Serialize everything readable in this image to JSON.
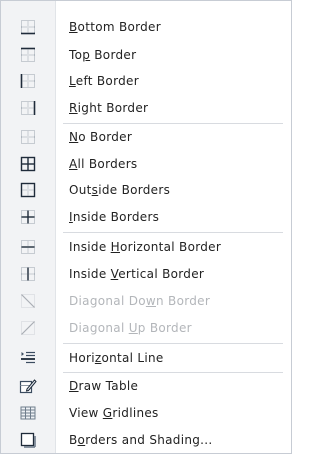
{
  "menu": {
    "items": [
      {
        "pre": "",
        "acc": "B",
        "post": "ottom Border",
        "icon": "border-bottom-icon",
        "enabled": true
      },
      {
        "pre": "To",
        "acc": "p",
        "post": " Border",
        "icon": "border-top-icon",
        "enabled": true
      },
      {
        "pre": "",
        "acc": "L",
        "post": "eft Border",
        "icon": "border-left-icon",
        "enabled": true
      },
      {
        "pre": "",
        "acc": "R",
        "post": "ight Border",
        "icon": "border-right-icon",
        "enabled": true
      },
      {
        "pre": "",
        "acc": "N",
        "post": "o Border",
        "icon": "no-border-icon",
        "enabled": true
      },
      {
        "pre": "",
        "acc": "A",
        "post": "ll Borders",
        "icon": "all-borders-icon",
        "enabled": true
      },
      {
        "pre": "Out",
        "acc": "s",
        "post": "ide Borders",
        "icon": "outside-borders-icon",
        "enabled": true
      },
      {
        "pre": "",
        "acc": "I",
        "post": "nside Borders",
        "icon": "inside-borders-icon",
        "enabled": true
      },
      {
        "pre": "Inside ",
        "acc": "H",
        "post": "orizontal Border",
        "icon": "inside-horizontal-border-icon",
        "enabled": true
      },
      {
        "pre": "Inside ",
        "acc": "V",
        "post": "ertical Border",
        "icon": "inside-vertical-border-icon",
        "enabled": true
      },
      {
        "pre": "Diagonal Do",
        "acc": "w",
        "post": "n Border",
        "icon": "diagonal-down-border-icon",
        "enabled": false
      },
      {
        "pre": "Diagonal ",
        "acc": "U",
        "post": "p Border",
        "icon": "diagonal-up-border-icon",
        "enabled": false
      },
      {
        "pre": "Hori",
        "acc": "z",
        "post": "ontal Line",
        "icon": "horizontal-line-icon",
        "enabled": true
      },
      {
        "pre": "",
        "acc": "D",
        "post": "raw Table",
        "icon": "draw-table-icon",
        "enabled": true
      },
      {
        "pre": "View ",
        "acc": "G",
        "post": "ridlines",
        "icon": "view-gridlines-icon",
        "enabled": true
      },
      {
        "pre": "B",
        "acc": "o",
        "post": "rders and Shading...",
        "icon": "borders-and-shading-icon",
        "enabled": true
      }
    ]
  }
}
